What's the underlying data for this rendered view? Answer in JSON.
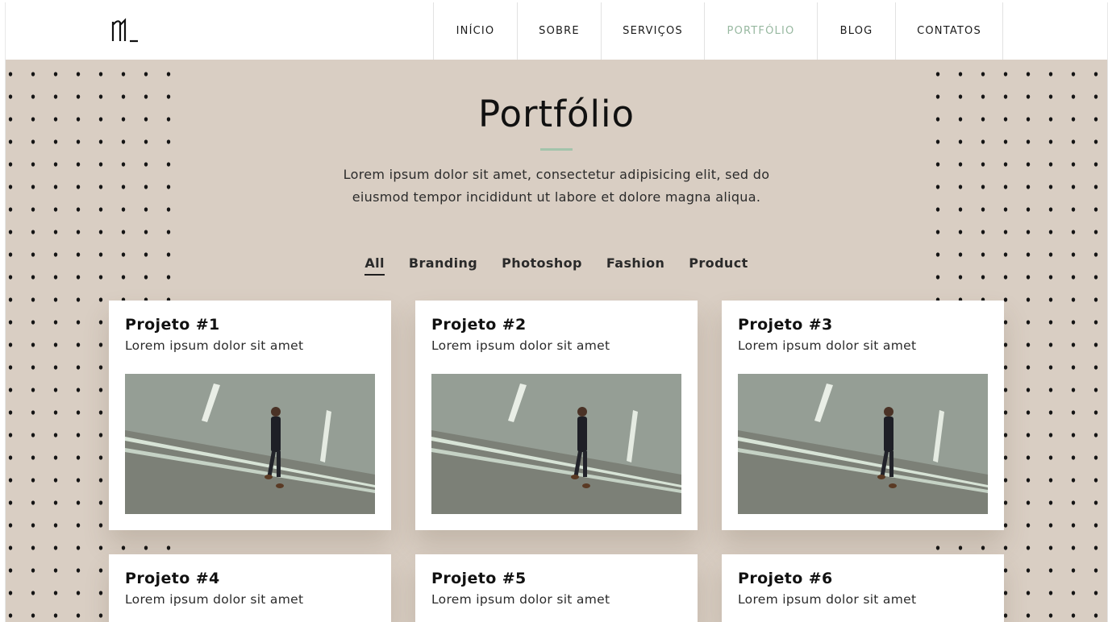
{
  "header": {
    "nav": [
      {
        "label": "INÍCIO",
        "active": false
      },
      {
        "label": "SOBRE",
        "active": false
      },
      {
        "label": "SERVIÇOS",
        "active": false
      },
      {
        "label": "PORTFÓLIO",
        "active": true
      },
      {
        "label": "BLOG",
        "active": false
      },
      {
        "label": "CONTATOS",
        "active": false
      }
    ]
  },
  "hero": {
    "title": "Portfólio",
    "description": "Lorem ipsum dolor sit amet, consectetur adipisicing elit, sed do eiusmod tempor incididunt ut labore et dolore magna aliqua."
  },
  "filters": [
    {
      "label": "All",
      "active": true
    },
    {
      "label": "Branding",
      "active": false
    },
    {
      "label": "Photoshop",
      "active": false
    },
    {
      "label": "Fashion",
      "active": false
    },
    {
      "label": "Product",
      "active": false
    }
  ],
  "projects": [
    {
      "title": "Projeto #1",
      "subtitle": "Lorem ipsum dolor sit amet"
    },
    {
      "title": "Projeto #2",
      "subtitle": "Lorem ipsum dolor sit amet"
    },
    {
      "title": "Projeto #3",
      "subtitle": "Lorem ipsum dolor sit amet"
    },
    {
      "title": "Projeto #4",
      "subtitle": "Lorem ipsum dolor sit amet"
    },
    {
      "title": "Projeto #5",
      "subtitle": "Lorem ipsum dolor sit amet"
    },
    {
      "title": "Projeto #6",
      "subtitle": "Lorem ipsum dolor sit amet"
    }
  ],
  "colors": {
    "background": "#d9cec3",
    "accent": "#97b8a0",
    "card": "#ffffff",
    "text": "#141414"
  }
}
